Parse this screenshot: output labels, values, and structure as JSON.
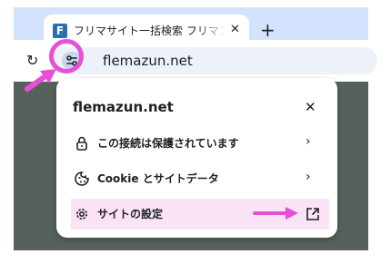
{
  "tab": {
    "favicon_letter": "F",
    "title": "フリマサイト一括検索 フリマズン",
    "close_glyph": "✕"
  },
  "newtab_glyph": "+",
  "toolbar": {
    "reload_glyph": "↻",
    "url": "flemazun.net"
  },
  "popup": {
    "title": "flemazun.net",
    "close_glyph": "✕",
    "items": [
      {
        "label": "この接続は保護されています",
        "icon": "lock-icon",
        "trailing": "chevron-right-icon"
      },
      {
        "label": "Cookie とサイトデータ",
        "icon": "cookie-icon",
        "trailing": "chevron-right-icon"
      },
      {
        "label": "サイトの設定",
        "icon": "gear-icon",
        "trailing": "external-link-icon"
      }
    ],
    "chevron_glyph": "›"
  },
  "colors": {
    "accent_pink": "#e84fd8",
    "tabstrip": "#d3e3fd",
    "page_background": "#56615b",
    "row_highlight": "#f9e3f5"
  }
}
